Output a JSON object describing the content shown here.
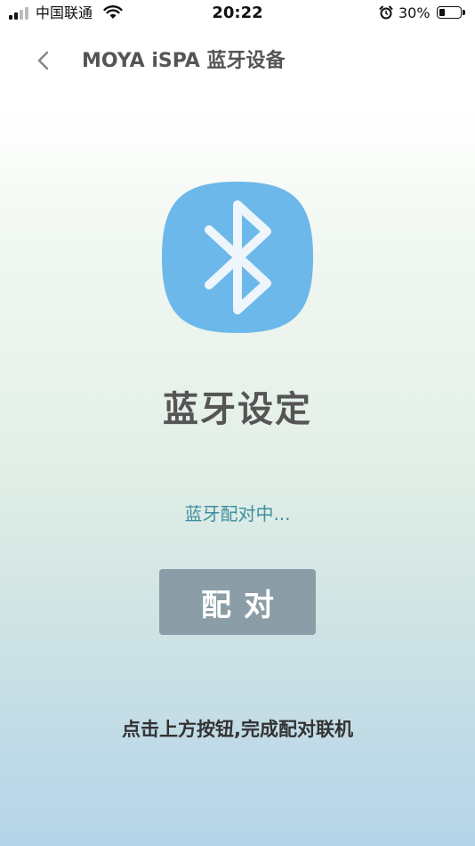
{
  "status_bar": {
    "carrier": "中国联通",
    "time": "20:22",
    "battery": "30%",
    "battery_level": 0.3,
    "icons": [
      "signal-icon",
      "wifi-icon",
      "alarm-icon",
      "battery-icon"
    ]
  },
  "nav": {
    "back_icon": "chevron-left-icon",
    "title": "MOYA iSPA 蓝牙设备"
  },
  "main": {
    "icon": "bluetooth-icon",
    "heading": "蓝牙设定",
    "status": "蓝牙配对中...",
    "pair_button_label": "配对",
    "hint": "点击上方按钮,完成配对联机"
  },
  "colors": {
    "bluetooth_tile": "#6db8ea",
    "pair_button": "#8b9da6",
    "status_text": "#3f8fa0"
  }
}
